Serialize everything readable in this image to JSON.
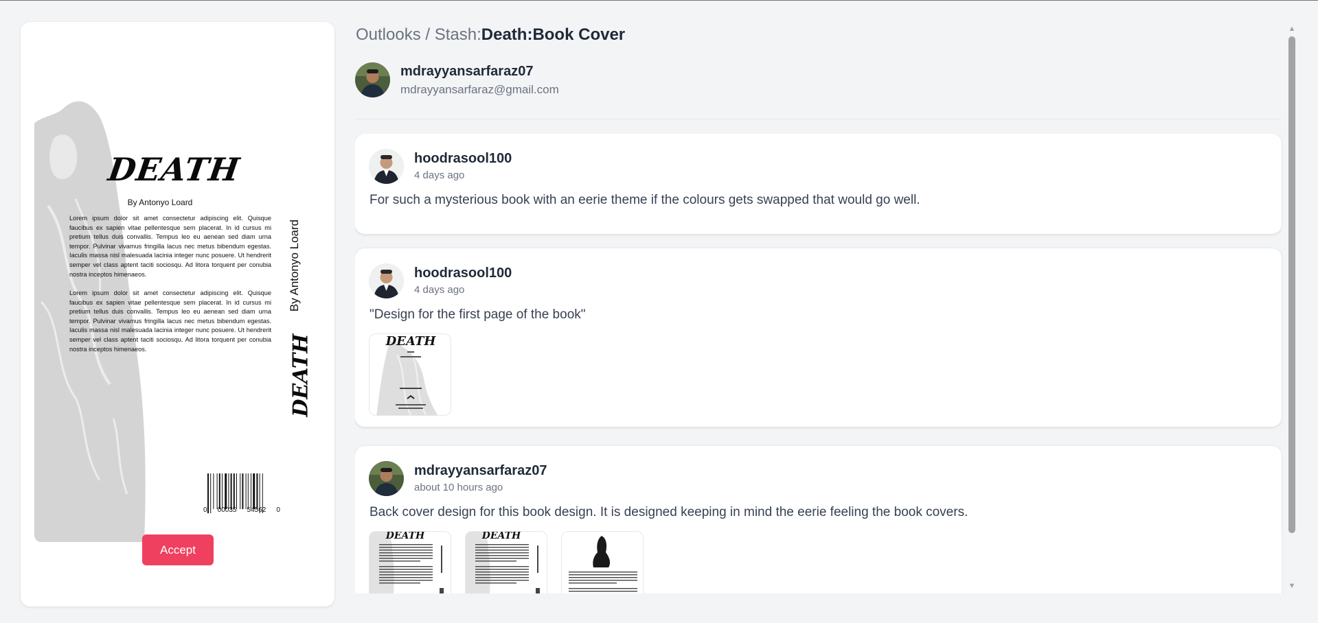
{
  "breadcrumb": {
    "path": "Outlooks / Stash:",
    "current": "Death:Book Cover"
  },
  "owner": {
    "username": "mdrayyansarfaraz07",
    "email": "mdrayyansarfaraz@gmail.com"
  },
  "cover": {
    "title": "DEATH",
    "author": "By Antonyo Loard",
    "paragraph": "Lorem ipsum dolor sit amet consectetur adipiscing elit. Quisque faucibus ex sapien vitae pellentesque sem placerat. In id cursus mi pretium tellus duis convallis. Tempus leo eu aenean sed diam urna tempor. Pulvinar vivamus fringilla lacus nec metus bibendum egestas. Iaculis massa nisl malesuada lacinia integer nunc posuere. Ut hendrerit semper vel class aptent taciti sociosqu. Ad litora torquent per conubia nostra inceptos himenaeos.",
    "spine_author": "By Antonyo Loard",
    "spine_title": "DEATH",
    "barcode_left": "0",
    "barcode_mid1": "00035",
    "barcode_mid2": "54562",
    "barcode_right": "0"
  },
  "accept_label": "Accept",
  "comments": [
    {
      "user": "hoodrasool100",
      "time": "4 days ago",
      "text": "For such a mysterious book with an eerie theme if the colours gets swapped that would go well."
    },
    {
      "user": "hoodrasool100",
      "time": "4 days ago",
      "text": "\"Design for the first page of the book\""
    },
    {
      "user": "mdrayyansarfaraz07",
      "time": "about 10 hours ago",
      "text": "Back cover design for this book design. It is designed keeping in mind the eerie feeling the book covers."
    }
  ],
  "colors": {
    "accent": "#f0405f",
    "background": "#f3f4f6",
    "card": "#ffffff"
  },
  "icons": {
    "scroll_up": "triangle-up-icon",
    "scroll_down": "triangle-down-icon"
  }
}
